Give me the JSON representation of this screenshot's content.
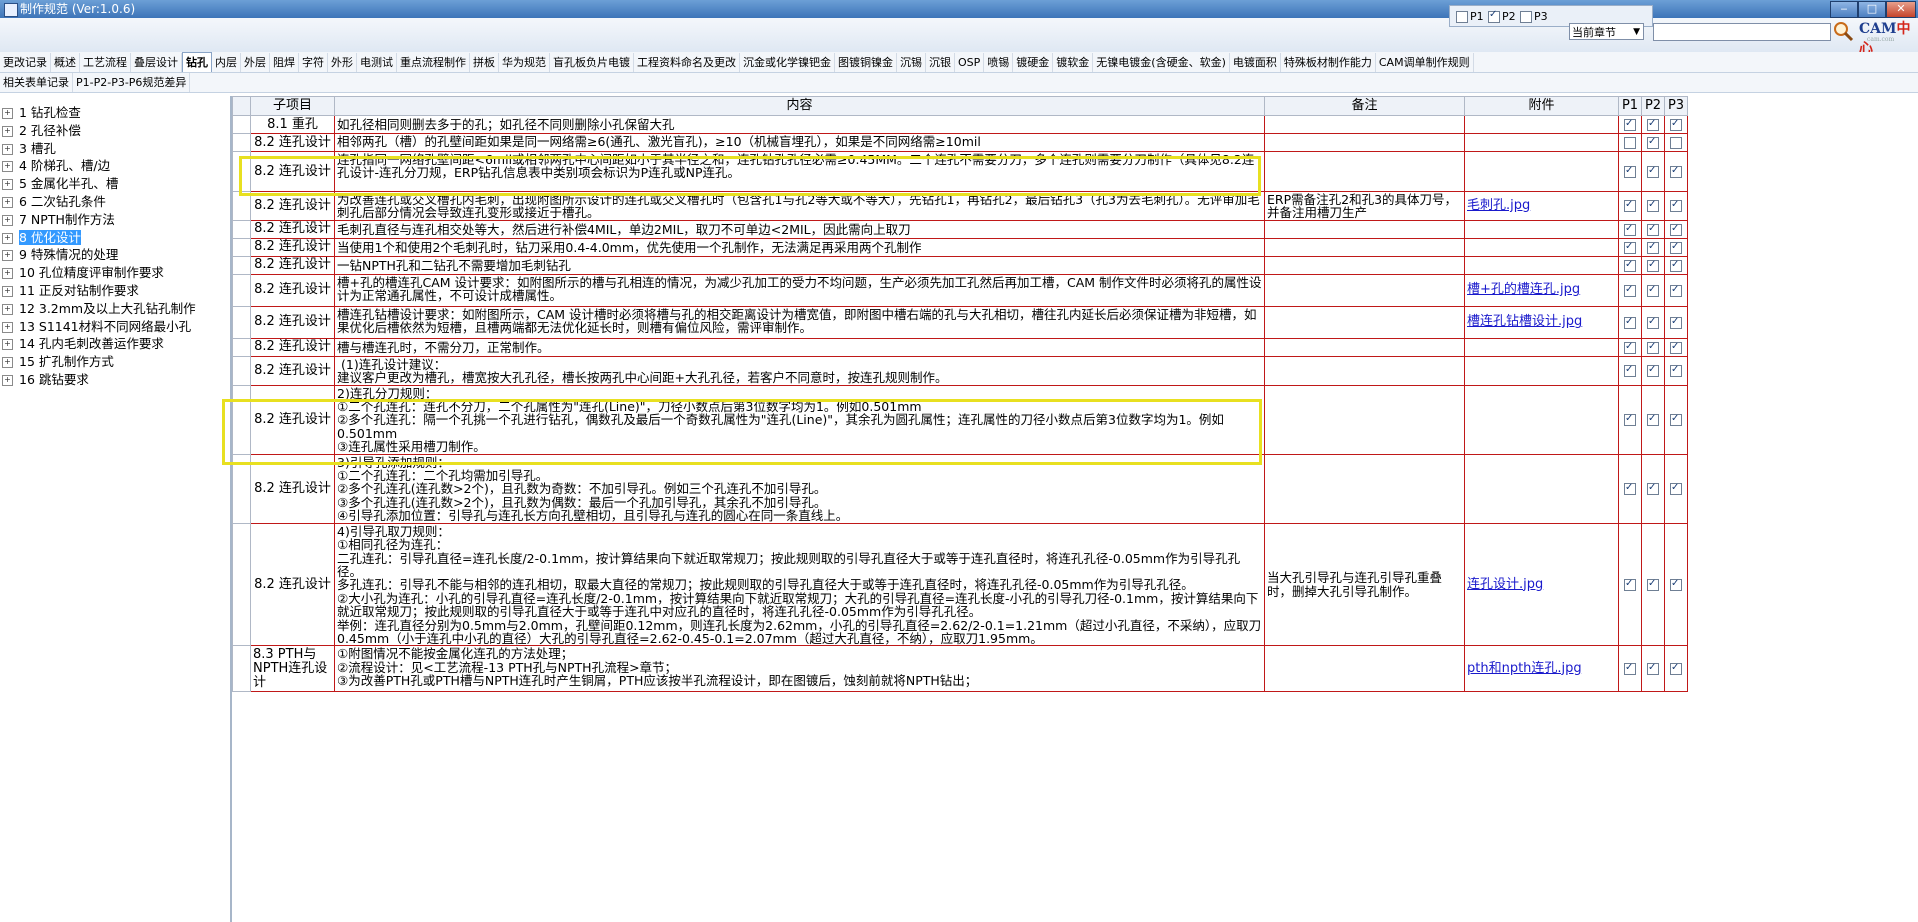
{
  "window": {
    "title": "制作规范 (Ver:1.0.6)"
  },
  "filter": {
    "items": [
      {
        "label": "P1",
        "checked": false
      },
      {
        "label": "P2",
        "checked": true
      },
      {
        "label": "P3",
        "checked": false
      }
    ],
    "scope_select": "当前章节",
    "search_value": ""
  },
  "logo": {
    "main_a": "CAM",
    "main_b": "中心",
    "sub": "cam.com"
  },
  "tabs_row1": [
    "更改记录",
    "概述",
    "工艺流程",
    "叠层设计",
    "钻孔",
    "内层",
    "外层",
    "阻焊",
    "字符",
    "外形",
    "电测试",
    "重点流程制作",
    "拼板",
    "华为规范",
    "盲孔板负片电镀",
    "工程资料命名及更改",
    "沉金或化学镍钯金",
    "图镀铜镍金",
    "沉锡",
    "沉银",
    "OSP",
    "喷锡",
    "镀硬金",
    "镀软金",
    "无镍电镀金(含硬金、软金)",
    "电镀面积",
    "特殊板材制作能力",
    "CAM调单制作规则"
  ],
  "tabs_row1_active": "钻孔",
  "tabs_row2": [
    "相关表单记录",
    "P1-P2-P3-P6规范差异"
  ],
  "tree": [
    "1 钻孔检查",
    "2 孔径补偿",
    "3 槽孔",
    "4 阶梯孔、槽/边",
    "5 金属化半孔、槽",
    "6 二次钻孔条件",
    "7 NPTH制作方法",
    "8 优化设计",
    "9 特殊情况的处理",
    "10 孔位精度评审制作要求",
    "11 正反对钻制作要求",
    "12 3.2mm及以上大孔钻孔制作",
    "13 S1141材料不同网络最小孔",
    "14 孔内毛刺改善运作要求",
    "15 扩孔制作方式",
    "16 跳钻要求"
  ],
  "tree_selected_index": 7,
  "table": {
    "headers": {
      "sub": "子项目",
      "content": "内容",
      "note": "备注",
      "attach": "附件",
      "p1": "P1",
      "p2": "P2",
      "p3": "P3"
    },
    "rows": [
      {
        "sub": "8.1 重孔",
        "content": "如孔径相同则删去多于的孔；如孔径不同则删除小孔保留大孔",
        "note": "",
        "attach": "",
        "p": [
          true,
          true,
          true
        ]
      },
      {
        "sub": "8.2 连孔设计",
        "content": "相邻两孔（槽）的孔壁间距如果是同一网络需≥6(通孔、激光盲孔)，≥10（机械盲埋孔），如果是不同网络需≥10mil",
        "note": "",
        "attach": "",
        "p": [
          false,
          true,
          false
        ]
      },
      {
        "sub": "8.2 连孔设计",
        "content": "连孔指同一网络孔壁间距<6mil或相邻两孔中心间距如小于其半径之和，连孔钻孔孔径必需≥0.45MM。二个连孔不需要分刀，多个连孔则需要分刀制作（具体见8.2连孔设计-连孔分刀规，ERP钻孔信息表中类别项会标识为P连孔或NP连孔。",
        "note": "",
        "attach": "",
        "p": [
          true,
          true,
          true
        ]
      },
      {
        "sub": "8.2 连孔设计",
        "content": "为改善连孔或交叉槽孔内毛刺，出现附图所示设计的连孔或交叉槽孔时（包含孔1与孔2等大或不等大），先钻孔1，再钻孔2，最后钻孔3（孔3为去毛刺孔）。无评审加毛刺孔后部分情况会导致连孔变形或接近于槽孔。",
        "note": "ERP需备注孔2和孔3的具体刀号，并备注用槽刀生产",
        "attach": "毛刺孔.jpg",
        "p": [
          true,
          true,
          true
        ]
      },
      {
        "sub": "8.2 连孔设计",
        "content": "毛刺孔直径与连孔相交处等大，然后进行补偿4MIL，单边2MIL，取刀不可单边<2MIL，因此需向上取刀",
        "note": "",
        "attach": "",
        "p": [
          true,
          true,
          true
        ]
      },
      {
        "sub": "8.2 连孔设计",
        "content": "当使用1个和使用2个毛刺孔时，钻刀采用0.4-4.0mm，优先使用一个孔制作，无法满足再采用两个孔制作",
        "note": "",
        "attach": "",
        "p": [
          true,
          true,
          true
        ]
      },
      {
        "sub": "8.2 连孔设计",
        "content": "一钻NPTH孔和二钻孔不需要增加毛刺钻孔",
        "note": "",
        "attach": "",
        "p": [
          true,
          true,
          true
        ]
      },
      {
        "sub": "8.2 连孔设计",
        "content": "槽+孔的槽连孔CAM 设计要求：如附图所示的槽与孔相连的情况，为减少孔加工的受力不均问题，生产必须先加工孔然后再加工槽，CAM 制作文件时必须将孔的属性设计为正常通孔属性，不可设计成槽属性。",
        "note": "",
        "attach": "槽+孔的槽连孔.jpg",
        "p": [
          true,
          true,
          true
        ]
      },
      {
        "sub": "8.2 连孔设计",
        "content": "槽连孔钻槽设计要求：如附图所示，CAM 设计槽时必须将槽与孔的相交距离设计为槽宽值，即附图中槽右端的孔与大孔相切，槽往孔内延长后必须保证槽为非短槽，如果优化后槽依然为短槽，且槽两端都无法优化延长时，则槽有偏位风险，需评审制作。",
        "note": "",
        "attach": "槽连孔钻槽设计.jpg",
        "p": [
          true,
          true,
          true
        ]
      },
      {
        "sub": "8.2 连孔设计",
        "content": "槽与槽连孔时，不需分刀，正常制作。",
        "note": "",
        "attach": "",
        "p": [
          true,
          true,
          true
        ]
      },
      {
        "sub": "8.2 连孔设计",
        "content": " (1)连孔设计建议：\n建议客户更改为槽孔，槽宽按大孔孔径，槽长按两孔中心间距+大孔孔径，若客户不同意时，按连孔规则制作。",
        "note": "",
        "attach": "",
        "p": [
          true,
          true,
          true
        ]
      },
      {
        "sub": "8.2 连孔设计",
        "content": "2)连孔分刀规则：\n①二个孔连孔：连孔不分刀，二个孔属性为\"连孔(Line)\"，刀径小数点后第3位数字均为1。例如0.501mm\n②多个孔连孔：隔一个孔挑一个孔进行钻孔，偶数孔及最后一个奇数孔属性为\"连孔(Line)\"，其余孔为圆孔属性；连孔属性的刀径小数点后第3位数字均为1。例如0.501mm\n③连孔属性采用槽刀制作。",
        "note": "",
        "attach": "",
        "p": [
          true,
          true,
          true
        ]
      },
      {
        "sub": "8.2 连孔设计",
        "content": "3)引导孔添加规则：\n①二个孔连孔：二个孔均需加引导孔。\n②多个孔连孔(连孔数>2个)，且孔数为奇数：不加引导孔。例如三个孔连孔不加引导孔。\n③多个孔连孔(连孔数>2个)，且孔数为偶数：最后一个孔加引导孔，其余孔不加引导孔。\n④引导孔添加位置：引导孔与连孔长方向孔壁相切，且引导孔与连孔的圆心在同一条直线上。",
        "note": "",
        "attach": "",
        "p": [
          true,
          true,
          true
        ]
      },
      {
        "sub": "8.2 连孔设计",
        "content": "4)引导孔取刀规则：\n①相同孔径为连孔：\n二孔连孔：引导孔直径=连孔长度/2-0.1mm，按计算结果向下就近取常规刀；按此规则取的引导孔直径大于或等于连孔直径时，将连孔孔径-0.05mm作为引导孔孔径。\n多孔连孔：引导孔不能与相邻的连孔相切，取最大直径的常规刀；按此规则取的引导孔直径大于或等于连孔直径时，将连孔孔径-0.05mm作为引导孔孔径。\n②大小孔为连孔：小孔的引导孔直径=连孔长度/2-0.1mm，按计算结果向下就近取常规刀；大孔的引导孔直径=连孔长度-小孔的引导孔刀径-0.1mm，按计算结果向下就近取常规刀；按此规则取的引导孔直径大于或等于连孔中对应孔的直径时，将连孔孔径-0.05mm作为引导孔孔径。\n举例：连孔直径分别为0.5mm与2.0mm，孔壁间距0.12mm，则连孔长度为2.62mm，小孔的引导孔直径=2.62/2-0.1=1.21mm（超过小孔直径，不采纳），应取刀0.45mm（小于连孔中小孔的直径）大孔的引导孔直径=2.62-0.45-0.1=2.07mm（超过大孔直径，不纳），应取刀1.95mm。",
        "note": "当大孔引导孔与连孔引导孔重叠时，删掉大孔引导孔制作。",
        "attach": "连孔设计.jpg",
        "p": [
          true,
          true,
          true
        ]
      },
      {
        "sub": "8.3 PTH与NPTH连孔设计",
        "content": "①附图情况不能按金属化连孔的方法处理；\n②流程设计：见<工艺流程-13 PTH孔与NPTH孔流程>章节；\n③为改善PTH孔或PTH槽与NPTH连孔时产生铜屑，PTH应该按半孔流程设计，即在图镀后，蚀刻前就将NPTH钻出；",
        "note": "",
        "attach": "pth和npth连孔.jpg",
        "p": [
          true,
          true,
          true
        ]
      }
    ]
  }
}
